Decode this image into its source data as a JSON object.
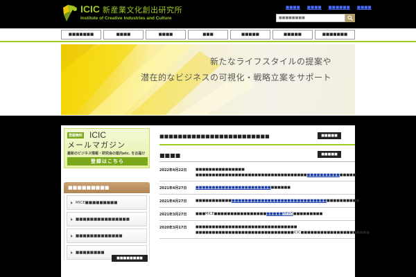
{
  "header": {
    "logo_title": "ICIC",
    "logo_title_jp": "新産業文化創出研究所",
    "logo_subtitle": "Institute of Creative Industries and Culture",
    "top_links": [
      "■■■■",
      "■■■■",
      "■■■■■■",
      "■■■■"
    ],
    "search_placeholder": "■■■■■■■■"
  },
  "nav": {
    "items": [
      "■■■■■■■",
      "■■■■",
      "■■■■",
      "■■■",
      "■■■■■",
      "■■■■■",
      "■■■■■■■"
    ]
  },
  "banner": {
    "line1": "新たなライフスタイルの提案や",
    "line2": "潜在的なビジネスの可視化・戦略立案をサポート"
  },
  "sidebar": {
    "magazine": {
      "free_label": "登録無料",
      "brand": "ICIC",
      "title": "メールマガジン",
      "desc": "最新のビジネス情報・研究会の案内etc. をお届け",
      "button": "登録はこちら"
    },
    "menu_title": "■■■■■■■■■",
    "menu_items": [
      "MICE■■■■■■■■■",
      "■■■■■■■■■■■■■■■",
      "■■■■■■■■■■■■■",
      "■■■■■■■■"
    ],
    "more_button": "■■■■■■■■"
  },
  "main": {
    "section1_title": "■■■■■■■■■■■■■■■■■■■■■■■■",
    "section1_button": "■■■■■",
    "section2_title": "■■■■",
    "section2_button": "■■■■■",
    "news": [
      {
        "date": "2022年4月22日",
        "pre": "■■■■■■■■■■■■■■■ ■■■■■■■■■■■■■■■■■■■■■■■■■■■■■■■■■■",
        "link": "■■■■■■■■■■",
        "post": "■■■■■"
      },
      {
        "date": "2021年4月27日",
        "pre": "",
        "link": "■■■■■■■■■■■■■■■■■■■■■■■",
        "post": "■■■■■■"
      },
      {
        "date": "2021年4月27日",
        "pre": "■■■■■■■■■■■",
        "link": "■■■■■■■■■■■■■■■■■■■■■■■■■■■■■",
        "post": "■■■■■■■■■■"
      },
      {
        "date": "2021年3月27日",
        "pre": "■■■MICE■■■■■■■■■■■■■■■■",
        "link": "■■■■■NEWS",
        "post": "■■■■■■■■■"
      },
      {
        "date": "2020年3月17日",
        "pre": "■■■■■■■■■■■■■■■■■■■■■■■■■■■■■■■ ■■■■■■■■■■■■■■■■■■■■■■■■■■■■■■ICIC■■■■■■■■■■■■■■■■■■■■■",
        "link": "",
        "post": ""
      }
    ]
  },
  "colors": {
    "accent_green": "#9fca1e",
    "link_blue": "#1a3da8",
    "menu_brown": "#b08553"
  }
}
